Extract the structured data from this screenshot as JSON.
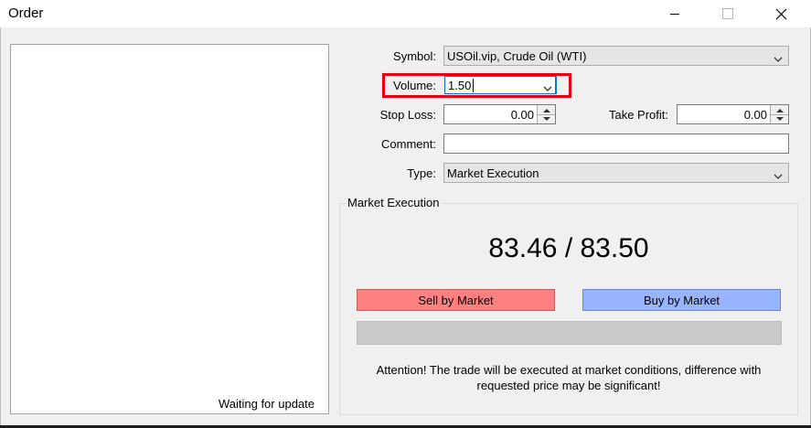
{
  "window": {
    "title": "Order",
    "minimize_icon": "minimize-icon",
    "maximize_icon": "maximize-icon",
    "close_icon": "close-icon"
  },
  "chart_panel": {
    "status": "Waiting for update"
  },
  "form": {
    "symbol_label": "Symbol:",
    "symbol_value": "USOil.vip, Crude Oil (WTI)",
    "volume_label": "Volume:",
    "volume_value": "1.50",
    "stop_loss_label": "Stop Loss:",
    "stop_loss_value": "0.00",
    "take_profit_label": "Take Profit:",
    "take_profit_value": "0.00",
    "comment_label": "Comment:",
    "comment_value": "",
    "type_label": "Type:",
    "type_value": "Market Execution"
  },
  "execution": {
    "group_title": "Market Execution",
    "price": "83.46 / 83.50",
    "sell_label": "Sell by Market",
    "buy_label": "Buy by Market",
    "attention_line1": "Attention! The trade will be executed at market conditions, difference with",
    "attention_line2": "requested price may be significant!"
  },
  "colors": {
    "sell": "#ff8080",
    "buy": "#99b4ff",
    "highlight": "#e60012"
  }
}
